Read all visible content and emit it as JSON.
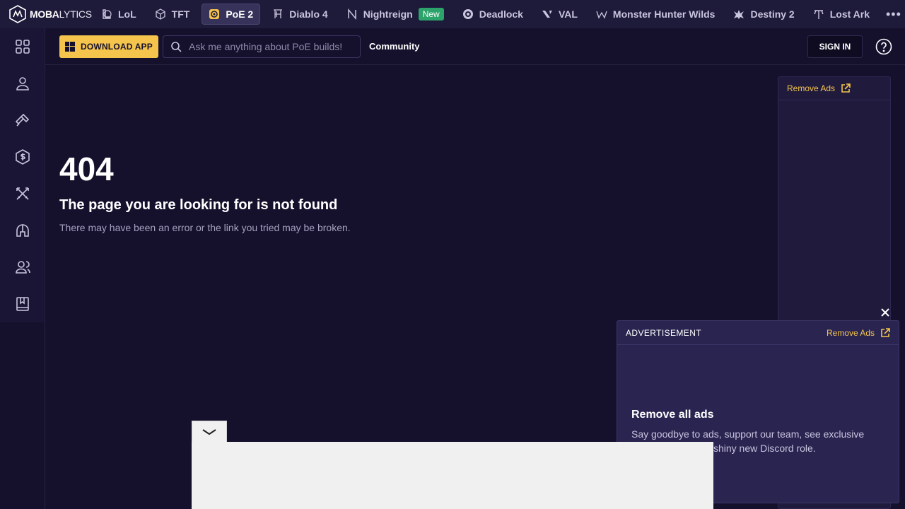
{
  "nav": {
    "logo_bold": "MOBA",
    "logo_rest": "LYTICS",
    "games": [
      {
        "label": "LoL",
        "icon": "lol-icon"
      },
      {
        "label": "TFT",
        "icon": "tft-icon"
      },
      {
        "label": "PoE 2",
        "icon": "poe2-icon"
      },
      {
        "label": "Diablo 4",
        "icon": "diablo-icon"
      },
      {
        "label": "Nightreign",
        "icon": "nightreign-icon",
        "badge": "New"
      },
      {
        "label": "Deadlock",
        "icon": "deadlock-icon"
      },
      {
        "label": "VAL",
        "icon": "valorant-icon"
      },
      {
        "label": "Monster Hunter Wilds",
        "icon": "monster-hunter-icon"
      },
      {
        "label": "Destiny 2",
        "icon": "destiny-icon"
      },
      {
        "label": "Lost Ark",
        "icon": "lost-ark-icon"
      }
    ],
    "active_game": "PoE 2",
    "more": "•••"
  },
  "header": {
    "download_label": "DOWNLOAD APP",
    "search_placeholder": "Ask me anything about PoE builds!",
    "community_label": "Community",
    "signin_label": "SIGN IN"
  },
  "error": {
    "code": "404",
    "title": "The page you are looking for is not found",
    "subtitle": "There may have been an error or the link you tried may be broken."
  },
  "side_ad": {
    "remove_label": "Remove Ads"
  },
  "float_ad": {
    "label": "ADVERTISEMENT",
    "remove_label": "Remove Ads",
    "title": "Remove all ads",
    "text": "Say goodbye to ads, support our team, see exclusive content, and get a shiny new Discord role."
  },
  "colors": {
    "accent": "#f4c44c",
    "background": "#15112d",
    "nav": "#1e1a3a",
    "new_badge": "#2ba36a"
  }
}
